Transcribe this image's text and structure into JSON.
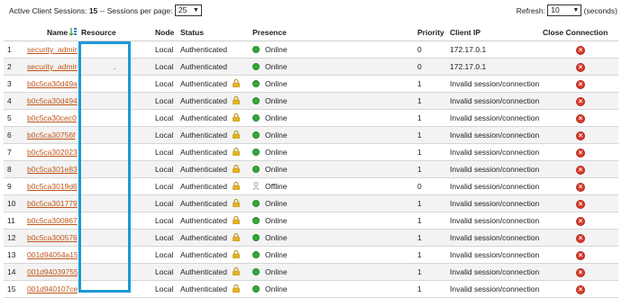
{
  "summary": {
    "label": "Active Client Sessions:",
    "count": "15",
    "per_page_label": "-- Sessions per page:",
    "per_page_value": "25"
  },
  "refresh": {
    "label": "Refresh:",
    "value": "10",
    "unit": "(seconds)"
  },
  "table": {
    "headers": {
      "name": "Name",
      "resource": "Resource",
      "node": "Node",
      "status": "Status",
      "presence": "Presence",
      "priority": "Priority",
      "client_ip": "Client IP",
      "close": "Close Connection"
    },
    "rows": [
      {
        "n": "1",
        "name": "security_admin",
        "resource": "",
        "node": "Local",
        "status": "Authenticated",
        "locked": false,
        "presence": "Online",
        "online": true,
        "priority": "0",
        "ip": "172.17.0.1"
      },
      {
        "n": "2",
        "name": "security_admin",
        "resource": ".",
        "node": "Local",
        "status": "Authenticated",
        "locked": false,
        "presence": "Online",
        "online": true,
        "priority": "0",
        "ip": "172.17.0.1"
      },
      {
        "n": "3",
        "name": "b0c5ca30d49a",
        "resource": "",
        "node": "Local",
        "status": "Authenticated",
        "locked": true,
        "presence": "Online",
        "online": true,
        "priority": "1",
        "ip": "Invalid session/connection"
      },
      {
        "n": "4",
        "name": "b0c5ca30d494",
        "resource": "",
        "node": "Local",
        "status": "Authenticated",
        "locked": true,
        "presence": "Online",
        "online": true,
        "priority": "1",
        "ip": "Invalid session/connection"
      },
      {
        "n": "5",
        "name": "b0c5ca30cec0",
        "resource": "",
        "node": "Local",
        "status": "Authenticated",
        "locked": true,
        "presence": "Online",
        "online": true,
        "priority": "1",
        "ip": "Invalid session/connection"
      },
      {
        "n": "6",
        "name": "b0c5ca30756f",
        "resource": "",
        "node": "Local",
        "status": "Authenticated",
        "locked": true,
        "presence": "Online",
        "online": true,
        "priority": "1",
        "ip": "Invalid session/connection"
      },
      {
        "n": "7",
        "name": "b0c5ca302023",
        "resource": "",
        "node": "Local",
        "status": "Authenticated",
        "locked": true,
        "presence": "Online",
        "online": true,
        "priority": "1",
        "ip": "Invalid session/connection"
      },
      {
        "n": "8",
        "name": "b0c5ca301e83",
        "resource": "",
        "node": "Local",
        "status": "Authenticated",
        "locked": true,
        "presence": "Online",
        "online": true,
        "priority": "1",
        "ip": "Invalid session/connection"
      },
      {
        "n": "9",
        "name": "b0c5ca3019d6",
        "resource": "",
        "node": "Local",
        "status": "Authenticated",
        "locked": true,
        "presence": "Offline",
        "online": false,
        "priority": "0",
        "ip": "Invalid session/connection"
      },
      {
        "n": "10",
        "name": "b0c5ca301779",
        "resource": "",
        "node": "Local",
        "status": "Authenticated",
        "locked": true,
        "presence": "Online",
        "online": true,
        "priority": "1",
        "ip": "Invalid session/connection"
      },
      {
        "n": "11",
        "name": "b0c5ca300867",
        "resource": "",
        "node": "Local",
        "status": "Authenticated",
        "locked": true,
        "presence": "Online",
        "online": true,
        "priority": "1",
        "ip": "Invalid session/connection"
      },
      {
        "n": "12",
        "name": "b0c5ca300576",
        "resource": "",
        "node": "Local",
        "status": "Authenticated",
        "locked": true,
        "presence": "Online",
        "online": true,
        "priority": "1",
        "ip": "Invalid session/connection"
      },
      {
        "n": "13",
        "name": "001d94054a15",
        "resource": "",
        "node": "Local",
        "status": "Authenticated",
        "locked": true,
        "presence": "Online",
        "online": true,
        "priority": "1",
        "ip": "Invalid session/connection"
      },
      {
        "n": "14",
        "name": "001d94039755",
        "resource": "",
        "node": "Local",
        "status": "Authenticated",
        "locked": true,
        "presence": "Online",
        "online": true,
        "priority": "1",
        "ip": "Invalid session/connection"
      },
      {
        "n": "15",
        "name": "001d940107ce",
        "resource": "",
        "node": "Local",
        "status": "Authenticated",
        "locked": true,
        "presence": "Online",
        "online": true,
        "priority": "1",
        "ip": "Invalid session/connection"
      }
    ]
  },
  "colors": {
    "link": "#c0561a",
    "online": "#34a83a",
    "close": "#d93a2a",
    "highlight": "#1a9ad6",
    "lock": "#e8b21c"
  }
}
